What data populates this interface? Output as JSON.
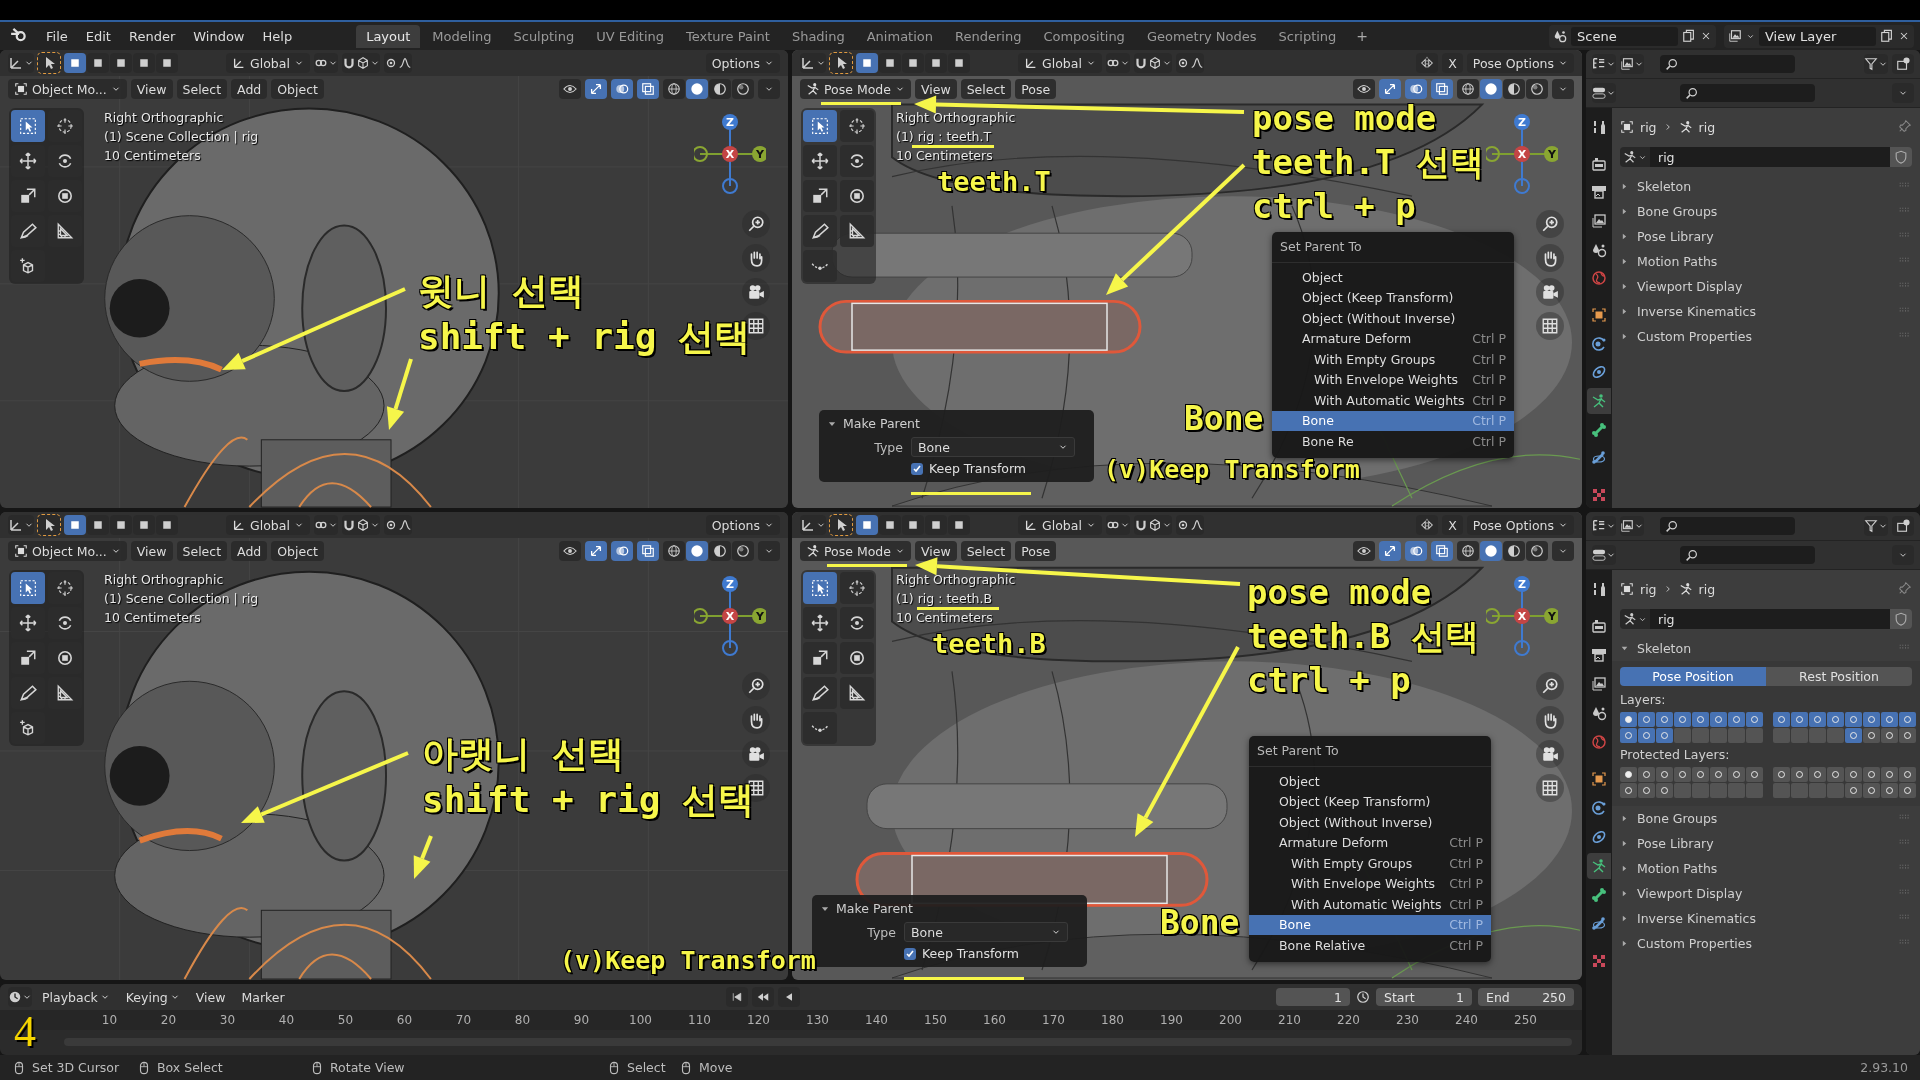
{
  "menubar": {
    "menus": [
      "File",
      "Edit",
      "Render",
      "Window",
      "Help"
    ],
    "workspaces": [
      {
        "label": "Layout",
        "selected": true
      },
      {
        "label": "Modeling",
        "selected": false
      },
      {
        "label": "Sculpting",
        "selected": false
      },
      {
        "label": "UV Editing",
        "selected": false
      },
      {
        "label": "Texture Paint",
        "selected": false
      },
      {
        "label": "Shading",
        "selected": false
      },
      {
        "label": "Animation",
        "selected": false
      },
      {
        "label": "Rendering",
        "selected": false
      },
      {
        "label": "Compositing",
        "selected": false
      },
      {
        "label": "Geometry Nodes",
        "selected": false
      },
      {
        "label": "Scripting",
        "selected": false
      }
    ],
    "add_workspace": "+",
    "scene": "Scene",
    "view_layer": "View Layer"
  },
  "viewports": [
    {
      "kind": "object",
      "transform": "Global",
      "options": "Options",
      "mode": "Object Mo...",
      "menus": [
        "View",
        "Select",
        "Add",
        "Object"
      ],
      "select_modes": [
        {
          "selected": true
        },
        {
          "selected": false
        },
        {
          "selected": false
        },
        {
          "selected": false
        },
        {
          "selected": false
        }
      ],
      "view_toggles": [
        {
          "selected": false
        },
        {
          "selected": true
        },
        {
          "selected": true
        },
        {
          "selected": true
        }
      ],
      "shading": [
        {
          "selected": false
        },
        {
          "selected": true
        },
        {
          "selected": false
        },
        {
          "selected": false
        }
      ],
      "overlay": [
        "Right Orthographic",
        "(1) Scene Collection | rig",
        "10 Centimeters"
      ],
      "axes": [
        "Z",
        "X",
        "Y"
      ],
      "tools": [
        {
          "kind": "select",
          "selected": true
        },
        {
          "kind": "cursor",
          "selected": false
        },
        {
          "kind": "move",
          "selected": false
        },
        {
          "kind": "rotate",
          "selected": false
        },
        {
          "kind": "scale",
          "selected": false
        },
        {
          "kind": "transform",
          "selected": false
        },
        {
          "kind": "annotate",
          "selected": false
        },
        {
          "kind": "measure",
          "selected": false
        },
        {
          "kind": "add-cube",
          "selected": false
        }
      ],
      "annotation": {
        "lines": [
          "윗니 선택",
          "shift + rig 선택"
        ]
      }
    },
    {
      "kind": "pose",
      "transform": "Global",
      "mirror": "X",
      "options": "Pose Options",
      "mode": "Pose Mode",
      "menus": [
        "View",
        "Select",
        "Pose"
      ],
      "select_modes": [
        {
          "selected": true
        },
        {
          "selected": false
        },
        {
          "selected": false
        },
        {
          "selected": false
        },
        {
          "selected": false
        }
      ],
      "view_toggles": [
        {
          "selected": false
        },
        {
          "selected": true
        },
        {
          "selected": true
        },
        {
          "selected": true
        }
      ],
      "shading": [
        {
          "selected": false
        },
        {
          "selected": true
        },
        {
          "selected": false
        },
        {
          "selected": false
        }
      ],
      "overlay": [
        "Right Orthographic",
        "(1) rig : teeth.T",
        "10 Centimeters"
      ],
      "axes": [
        "Z",
        "X",
        "Y"
      ],
      "tools": [
        {
          "kind": "select",
          "selected": true
        },
        {
          "kind": "cursor",
          "selected": false
        },
        {
          "kind": "move",
          "selected": false
        },
        {
          "kind": "rotate",
          "selected": false
        },
        {
          "kind": "scale",
          "selected": false
        },
        {
          "kind": "transform",
          "selected": false
        },
        {
          "kind": "annotate",
          "selected": false
        },
        {
          "kind": "measure",
          "selected": false
        },
        {
          "kind": "relax",
          "selected": false
        }
      ],
      "annotation": {
        "lines": [
          "pose mode",
          "teeth.T 선택",
          "ctrl + p"
        ],
        "label": "teeth.T",
        "note": "(v)Keep Transform",
        "pick": "Bone"
      },
      "menu": {
        "title": "Set Parent To",
        "items": [
          {
            "label": "Object",
            "selected": false
          },
          {
            "label": "Object (Keep Transform)",
            "selected": false
          },
          {
            "label": "Object (Without Inverse)",
            "selected": false
          },
          {
            "label": "Armature Deform",
            "shortcut": "Ctrl P",
            "selected": false,
            "children": [
              {
                "label": "With Empty Groups",
                "shortcut": "Ctrl P",
                "selected": false
              },
              {
                "label": "With Envelope Weights",
                "shortcut": "Ctrl P",
                "selected": false
              },
              {
                "label": "With Automatic Weights",
                "shortcut": "Ctrl P",
                "selected": false
              }
            ]
          },
          {
            "label": "Bone",
            "shortcut": "Ctrl P",
            "selected": true
          },
          {
            "label": "Bone Re",
            "shortcut": "Ctrl P",
            "selected": false
          }
        ]
      },
      "make_parent": {
        "title": "Make Parent",
        "type_label": "Type",
        "type_value": "Bone",
        "option": {
          "label": "Keep Transform",
          "checked": true
        }
      }
    },
    {
      "kind": "object",
      "transform": "Global",
      "options": "Options",
      "mode": "Object Mo...",
      "menus": [
        "View",
        "Select",
        "Add",
        "Object"
      ],
      "select_modes": [
        {
          "selected": true
        },
        {
          "selected": false
        },
        {
          "selected": false
        },
        {
          "selected": false
        },
        {
          "selected": false
        }
      ],
      "view_toggles": [
        {
          "selected": false
        },
        {
          "selected": true
        },
        {
          "selected": true
        },
        {
          "selected": true
        }
      ],
      "shading": [
        {
          "selected": false
        },
        {
          "selected": true
        },
        {
          "selected": false
        },
        {
          "selected": false
        }
      ],
      "overlay": [
        "Right Orthographic",
        "(1) Scene Collection | rig",
        "10 Centimeters"
      ],
      "axes": [
        "Z",
        "X",
        "Y"
      ],
      "tools": [
        {
          "kind": "select",
          "selected": true
        },
        {
          "kind": "cursor",
          "selected": false
        },
        {
          "kind": "move",
          "selected": false
        },
        {
          "kind": "rotate",
          "selected": false
        },
        {
          "kind": "scale",
          "selected": false
        },
        {
          "kind": "transform",
          "selected": false
        },
        {
          "kind": "annotate",
          "selected": false
        },
        {
          "kind": "measure",
          "selected": false
        },
        {
          "kind": "add-cube",
          "selected": false
        }
      ],
      "annotation": {
        "lines": [
          "아랫니 선택",
          "shift + rig 선택"
        ]
      }
    },
    {
      "kind": "pose",
      "transform": "Global",
      "mirror": "X",
      "options": "Pose Options",
      "mode": "Pose Mode",
      "menus": [
        "View",
        "Select",
        "Pose"
      ],
      "select_modes": [
        {
          "selected": true
        },
        {
          "selected": false
        },
        {
          "selected": false
        },
        {
          "selected": false
        },
        {
          "selected": false
        }
      ],
      "view_toggles": [
        {
          "selected": false
        },
        {
          "selected": true
        },
        {
          "selected": true
        },
        {
          "selected": true
        }
      ],
      "shading": [
        {
          "selected": false
        },
        {
          "selected": true
        },
        {
          "selected": false
        },
        {
          "selected": false
        }
      ],
      "overlay": [
        "Right Orthographic",
        "(1) rig : teeth.B",
        "10 Centimeters"
      ],
      "axes": [
        "Z",
        "X",
        "Y"
      ],
      "tools": [
        {
          "kind": "select",
          "selected": true
        },
        {
          "kind": "cursor",
          "selected": false
        },
        {
          "kind": "move",
          "selected": false
        },
        {
          "kind": "rotate",
          "selected": false
        },
        {
          "kind": "scale",
          "selected": false
        },
        {
          "kind": "transform",
          "selected": false
        },
        {
          "kind": "annotate",
          "selected": false
        },
        {
          "kind": "measure",
          "selected": false
        },
        {
          "kind": "relax",
          "selected": false
        }
      ],
      "annotation": {
        "lines": [
          "pose mode",
          "teeth.B 선택",
          "ctrl + p"
        ],
        "label": "teeth.B",
        "note": "(v)Keep Transform",
        "pick": "Bone"
      },
      "menu": {
        "title": "Set Parent To",
        "items": [
          {
            "label": "Object",
            "selected": false
          },
          {
            "label": "Object (Keep Transform)",
            "selected": false
          },
          {
            "label": "Object (Without Inverse)",
            "selected": false
          },
          {
            "label": "Armature Deform",
            "shortcut": "Ctrl P",
            "selected": false,
            "children": [
              {
                "label": "With Empty Groups",
                "shortcut": "Ctrl P",
                "selected": false
              },
              {
                "label": "With Envelope Weights",
                "shortcut": "Ctrl P",
                "selected": false
              },
              {
                "label": "With Automatic Weights",
                "shortcut": "Ctrl P",
                "selected": false
              }
            ]
          },
          {
            "label": "Bone",
            "shortcut": "Ctrl P",
            "selected": true
          },
          {
            "label": "Bone Relative",
            "shortcut": "Ctrl P",
            "selected": false
          }
        ]
      },
      "make_parent": {
        "title": "Make Parent",
        "type_label": "Type",
        "type_value": "Bone",
        "option": {
          "label": "Keep Transform",
          "checked": true
        }
      }
    }
  ],
  "properties": [
    {
      "breadcrumb": [
        "rig",
        "rig"
      ],
      "datablock": "rig",
      "tabs": [
        {
          "kind": "tool",
          "selected": false
        },
        {
          "kind": "render",
          "selected": false
        },
        {
          "kind": "output",
          "selected": false
        },
        {
          "kind": "view-layer",
          "selected": false
        },
        {
          "kind": "scene",
          "selected": false
        },
        {
          "kind": "world",
          "selected": false
        },
        {
          "kind": "object",
          "selected": false
        },
        {
          "kind": "physics",
          "selected": false
        },
        {
          "kind": "constraints",
          "selected": false
        },
        {
          "kind": "data",
          "selected": true
        },
        {
          "kind": "bone",
          "selected": false
        },
        {
          "kind": "bone-constraints",
          "selected": false
        },
        {
          "kind": "texture",
          "selected": false
        }
      ],
      "sections": [
        {
          "label": "Skeleton",
          "expanded": false
        },
        {
          "label": "Bone Groups",
          "expanded": false
        },
        {
          "label": "Pose Library",
          "expanded": false
        },
        {
          "label": "Motion Paths",
          "expanded": false
        },
        {
          "label": "Viewport Display",
          "expanded": false
        },
        {
          "label": "Inverse Kinematics",
          "expanded": false
        },
        {
          "label": "Custom Properties",
          "expanded": false
        }
      ]
    },
    {
      "breadcrumb": [
        "rig",
        "rig"
      ],
      "datablock": "rig",
      "tabs": [
        {
          "kind": "tool",
          "selected": false
        },
        {
          "kind": "render",
          "selected": false
        },
        {
          "kind": "output",
          "selected": false
        },
        {
          "kind": "view-layer",
          "selected": false
        },
        {
          "kind": "scene",
          "selected": false
        },
        {
          "kind": "world",
          "selected": false
        },
        {
          "kind": "object",
          "selected": false
        },
        {
          "kind": "physics",
          "selected": false
        },
        {
          "kind": "constraints",
          "selected": false
        },
        {
          "kind": "data",
          "selected": true
        },
        {
          "kind": "bone",
          "selected": false
        },
        {
          "kind": "bone-constraints",
          "selected": false
        },
        {
          "kind": "texture",
          "selected": false
        }
      ],
      "sections": [
        {
          "label": "Skeleton",
          "expanded": true,
          "positions": [
            {
              "label": "Pose Position",
              "selected": true
            },
            {
              "label": "Rest Position",
              "selected": false
            }
          ],
          "layers_label": "Layers:",
          "layers": [
            {
              "rows": [
                [
                  {
                    "selected": true,
                    "used": true,
                    "active": true
                  },
                  {
                    "selected": true,
                    "used": true,
                    "active": false
                  },
                  {
                    "selected": true,
                    "used": true,
                    "active": false
                  },
                  {
                    "selected": true,
                    "used": true,
                    "active": false
                  },
                  {
                    "selected": true,
                    "used": true,
                    "active": false
                  },
                  {
                    "selected": true,
                    "used": true,
                    "active": false
                  },
                  {
                    "selected": true,
                    "used": true,
                    "active": false
                  },
                  {
                    "selected": true,
                    "used": true,
                    "active": false
                  }
                ],
                [
                  {
                    "selected": true,
                    "used": true,
                    "active": false
                  },
                  {
                    "selected": true,
                    "used": true,
                    "active": false
                  },
                  {
                    "selected": true,
                    "used": true,
                    "active": false
                  },
                  {
                    "selected": false,
                    "used": false,
                    "active": false
                  },
                  {
                    "selected": false,
                    "used": false,
                    "active": false
                  },
                  {
                    "selected": false,
                    "used": false,
                    "active": false
                  },
                  {
                    "selected": false,
                    "used": false,
                    "active": false
                  },
                  {
                    "selected": false,
                    "used": false,
                    "active": false
                  }
                ]
              ]
            },
            {
              "rows": [
                [
                  {
                    "selected": true,
                    "used": true,
                    "active": false
                  },
                  {
                    "selected": true,
                    "used": true,
                    "active": false
                  },
                  {
                    "selected": true,
                    "used": true,
                    "active": false
                  },
                  {
                    "selected": true,
                    "used": true,
                    "active": false
                  },
                  {
                    "selected": true,
                    "used": true,
                    "active": false
                  },
                  {
                    "selected": true,
                    "used": true,
                    "active": false
                  },
                  {
                    "selected": true,
                    "used": true,
                    "active": false
                  },
                  {
                    "selected": true,
                    "used": true,
                    "active": false
                  }
                ],
                [
                  {
                    "selected": false,
                    "used": false,
                    "active": false
                  },
                  {
                    "selected": false,
                    "used": false,
                    "active": false
                  },
                  {
                    "selected": false,
                    "used": false,
                    "active": false
                  },
                  {
                    "selected": false,
                    "used": false,
                    "active": false
                  },
                  {
                    "selected": true,
                    "used": true,
                    "active": false
                  },
                  {
                    "selected": false,
                    "used": true,
                    "active": false
                  },
                  {
                    "selected": false,
                    "used": true,
                    "active": false
                  },
                  {
                    "selected": false,
                    "used": true,
                    "active": false
                  }
                ]
              ]
            }
          ],
          "protected_label": "Protected Layers:",
          "protected_layers": [
            {
              "rows": [
                [
                  {
                    "selected": false,
                    "used": true,
                    "active": true
                  },
                  {
                    "selected": false,
                    "used": true,
                    "active": false
                  },
                  {
                    "selected": false,
                    "used": true,
                    "active": false
                  },
                  {
                    "selected": false,
                    "used": true,
                    "active": false
                  },
                  {
                    "selected": false,
                    "used": true,
                    "active": false
                  },
                  {
                    "selected": false,
                    "used": true,
                    "active": false
                  },
                  {
                    "selected": false,
                    "used": true,
                    "active": false
                  },
                  {
                    "selected": false,
                    "used": true,
                    "active": false
                  }
                ],
                [
                  {
                    "selected": false,
                    "used": true,
                    "active": false
                  },
                  {
                    "selected": false,
                    "used": true,
                    "active": false
                  },
                  {
                    "selected": false,
                    "used": true,
                    "active": false
                  },
                  {
                    "selected": false,
                    "used": false,
                    "active": false
                  },
                  {
                    "selected": false,
                    "used": false,
                    "active": false
                  },
                  {
                    "selected": false,
                    "used": false,
                    "active": false
                  },
                  {
                    "selected": false,
                    "used": false,
                    "active": false
                  },
                  {
                    "selected": false,
                    "used": false,
                    "active": false
                  }
                ]
              ]
            },
            {
              "rows": [
                [
                  {
                    "selected": false,
                    "used": true,
                    "active": false
                  },
                  {
                    "selected": false,
                    "used": true,
                    "active": false
                  },
                  {
                    "selected": false,
                    "used": true,
                    "active": false
                  },
                  {
                    "selected": false,
                    "used": true,
                    "active": false
                  },
                  {
                    "selected": false,
                    "used": true,
                    "active": false
                  },
                  {
                    "selected": false,
                    "used": true,
                    "active": false
                  },
                  {
                    "selected": false,
                    "used": true,
                    "active": false
                  },
                  {
                    "selected": false,
                    "used": true,
                    "active": false
                  }
                ],
                [
                  {
                    "selected": false,
                    "used": false,
                    "active": false
                  },
                  {
                    "selected": false,
                    "used": false,
                    "active": false
                  },
                  {
                    "selected": false,
                    "used": false,
                    "active": false
                  },
                  {
                    "selected": false,
                    "used": false,
                    "active": false
                  },
                  {
                    "selected": false,
                    "used": true,
                    "active": false
                  },
                  {
                    "selected": false,
                    "used": true,
                    "active": false
                  },
                  {
                    "selected": false,
                    "used": true,
                    "active": false
                  },
                  {
                    "selected": false,
                    "used": true,
                    "active": false
                  }
                ]
              ]
            }
          ]
        },
        {
          "label": "Bone Groups",
          "expanded": false
        },
        {
          "label": "Pose Library",
          "expanded": false
        },
        {
          "label": "Motion Paths",
          "expanded": false
        },
        {
          "label": "Viewport Display",
          "expanded": false
        },
        {
          "label": "Inverse Kinematics",
          "expanded": false
        },
        {
          "label": "Custom Properties",
          "expanded": false
        }
      ]
    }
  ],
  "timeline": {
    "menus": [
      {
        "label": "Playback",
        "dropdown": true
      },
      {
        "label": "Keying",
        "dropdown": true
      },
      {
        "label": "View",
        "dropdown": false
      },
      {
        "label": "Marker",
        "dropdown": false
      }
    ],
    "frame": "1",
    "start_label": "Start",
    "start": "1",
    "end_label": "End",
    "end": "250",
    "ticks": [
      "10",
      "20",
      "30",
      "40",
      "50",
      "60",
      "70",
      "80",
      "90",
      "100",
      "110",
      "120",
      "130",
      "140",
      "150",
      "160",
      "170",
      "180",
      "190",
      "200",
      "210",
      "220",
      "230",
      "240",
      "250"
    ]
  },
  "status_bar": {
    "hints": [
      "Set 3D Cursor",
      "Box Select",
      "Rotate View",
      "Select",
      "Move"
    ],
    "version": "2.93.10"
  },
  "step_number": "4"
}
